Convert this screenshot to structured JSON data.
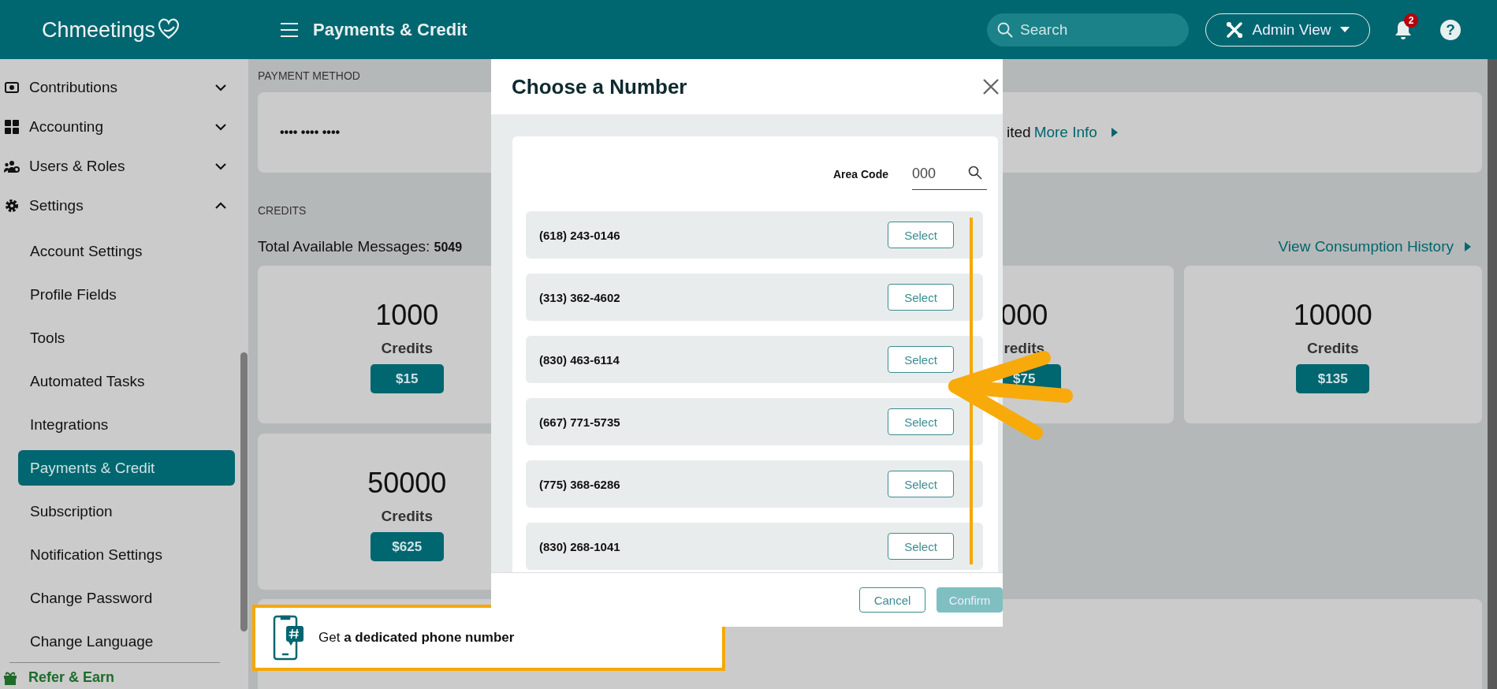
{
  "header": {
    "logo": "Chmeetings",
    "title": "Payments & Credit",
    "search": {
      "placeholder": "Search"
    },
    "view_button": "Admin View",
    "notifications": {
      "badge": "2"
    },
    "help": "?"
  },
  "sidebar": {
    "items": [
      {
        "label": "Contributions",
        "expanded": false
      },
      {
        "label": "Accounting",
        "expanded": false
      },
      {
        "label": "Users & Roles",
        "expanded": false
      },
      {
        "label": "Settings",
        "expanded": true,
        "children": [
          {
            "label": "Account Settings",
            "selected": false
          },
          {
            "label": "Profile Fields",
            "selected": false
          },
          {
            "label": "Tools",
            "selected": false
          },
          {
            "label": "Automated Tasks",
            "selected": false
          },
          {
            "label": "Integrations",
            "selected": false
          },
          {
            "label": "Payments & Credit",
            "selected": true
          },
          {
            "label": "Subscription",
            "selected": false
          },
          {
            "label": "Notification Settings",
            "selected": false
          },
          {
            "label": "Change Password",
            "selected": false
          },
          {
            "label": "Change Language",
            "selected": false
          }
        ]
      }
    ],
    "footer_link": "Refer & Earn"
  },
  "payment_method": {
    "heading": "PAYMENT METHOD",
    "card_mask": "•••• •••• ••••",
    "note_fragment": "ited",
    "link": "More Info"
  },
  "credits": {
    "heading": "CREDITS",
    "total_label": "Total Available Messages:",
    "total": "5049",
    "history_link": "View Consumption History",
    "packages": [
      {
        "amount": "1000",
        "unit": "Credits",
        "price": "$15"
      },
      {
        "amount": "000",
        "unit": "redits",
        "price": "$75"
      },
      {
        "amount": "10000",
        "unit": "Credits",
        "price": "$135"
      },
      {
        "amount": "50000",
        "unit": "Credits",
        "price": "$625"
      }
    ]
  },
  "promo": {
    "text": "Get **a dedicated phone number**"
  },
  "dialog": {
    "title": "Choose a Number",
    "area_code": {
      "label": "Area Code",
      "placeholder": "000"
    },
    "numbers": [
      {
        "number": "(618) 243-0146",
        "action": "Select"
      },
      {
        "number": "(313) 362-4602",
        "action": "Select"
      },
      {
        "number": "(830) 463-6114",
        "action": "Select"
      },
      {
        "number": "(667) 771-5735",
        "action": "Select"
      },
      {
        "number": "(775) 368-6286",
        "action": "Select"
      },
      {
        "number": "(830) 268-1041",
        "action": "Select"
      }
    ],
    "buttons": [
      {
        "label": "Cancel",
        "primary": false,
        "disabled": false
      },
      {
        "label": "Confirm",
        "primary": true,
        "disabled": true
      }
    ]
  }
}
